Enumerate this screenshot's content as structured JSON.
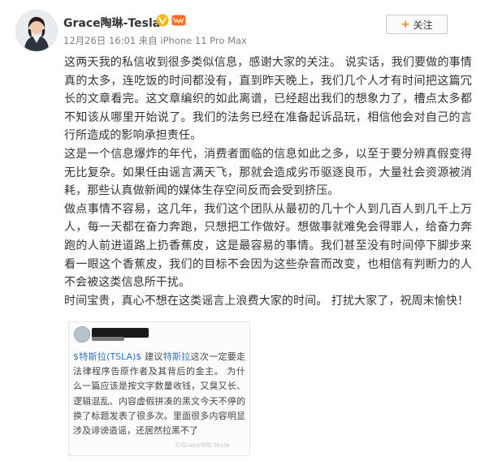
{
  "user": {
    "name": "Grace陶琳-Tesla"
  },
  "meta": {
    "date": "12月26日",
    "time": "16:01",
    "source": "来自 iPhone 11 Pro Max"
  },
  "follow": {
    "icon": "+",
    "label": "关注"
  },
  "post": {
    "paragraphs": [
      "这两天我的私信收到很多类似信息，感谢大家的关注。 说实话，我们要做的事情真的太多，连吃饭的时间都没有，直到昨天晚上，我们几个人才有时间把这篇冗长的文章看完。这文章编织的如此离谱，已经超出我们的想象力了，槽点太多都不知该从哪里开始说了。我们的法务已经在准备起诉品玩，相信他会对自己的言行所造成的影响承担责任。",
      "这是一个信息爆炸的年代，消费者面临的信息如此之多，以至于要分辨真假变得无比复杂。如果任由谣言满天飞，那就会造成劣币驱逐良币，大量社会资源被消耗，那些认真做新闻的媒体生存空间反而会受到挤压。",
      "做点事情不容易，这几年，我们这个团队从最初的几十个人到几百人到几千上万人，每一天都在奋力奔跑，只想把工作做好。想做事就难免会得罪人，给奋力奔跑的人前进道路上扔香蕉皮，这是最容易的事情。我们甚至没有时间停下脚步来看一眼这个香蕉皮，我们的目标不会因为这些杂音而改变，也相信有判断力的人不会被这类信息所干扰。",
      "时间宝贵，真心不想在这类谣言上浪费大家的时间。 打扰大家了，祝周末愉快！"
    ]
  },
  "embedded": {
    "link": "$特斯拉(TSLA)$",
    "pre": " 建议",
    "mention": "特斯拉",
    "body": "这次一定要走法律程序告原作者及其背后的金主。 为什么一篇应该是按文字数量收钱，又臭又长、逻辑混乱、内容虚假拼凑的黑文今天不停的换了标题发表了很多次。里面很多内容明显涉及诽谤造谣，还居然拉黑不了",
    "watermark": "©GraceWB·Tesla"
  }
}
